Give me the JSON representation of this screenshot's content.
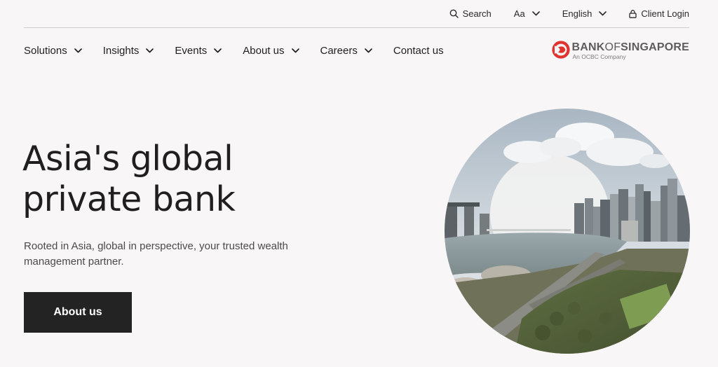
{
  "utility": {
    "search_label": "Search",
    "font_size_label": "Aa",
    "language_label": "English",
    "client_login_label": "Client Login"
  },
  "nav": {
    "items": [
      {
        "label": "Solutions",
        "has_menu": true
      },
      {
        "label": "Insights",
        "has_menu": true
      },
      {
        "label": "Events",
        "has_menu": true
      },
      {
        "label": "About us",
        "has_menu": true
      },
      {
        "label": "Careers",
        "has_menu": true
      },
      {
        "label": "Contact us",
        "has_menu": false
      }
    ]
  },
  "logo": {
    "bank": "BANK",
    "of": "OF",
    "singapore": "SINGAPORE",
    "tagline": "An OCBC Company"
  },
  "hero": {
    "title_line1": "Asia's global",
    "title_line2": "private bank",
    "subtitle": "Rooted in Asia, global in perspective, your trusted wealth management partner.",
    "cta_label": "About us"
  },
  "colors": {
    "background": "#f8f6f6",
    "button": "#232323",
    "brand_red": "#e0332e",
    "text": "#1f1f1f"
  },
  "icons": [
    "search-icon",
    "chevron-down-icon",
    "lock-icon",
    "bank-logo-icon"
  ]
}
